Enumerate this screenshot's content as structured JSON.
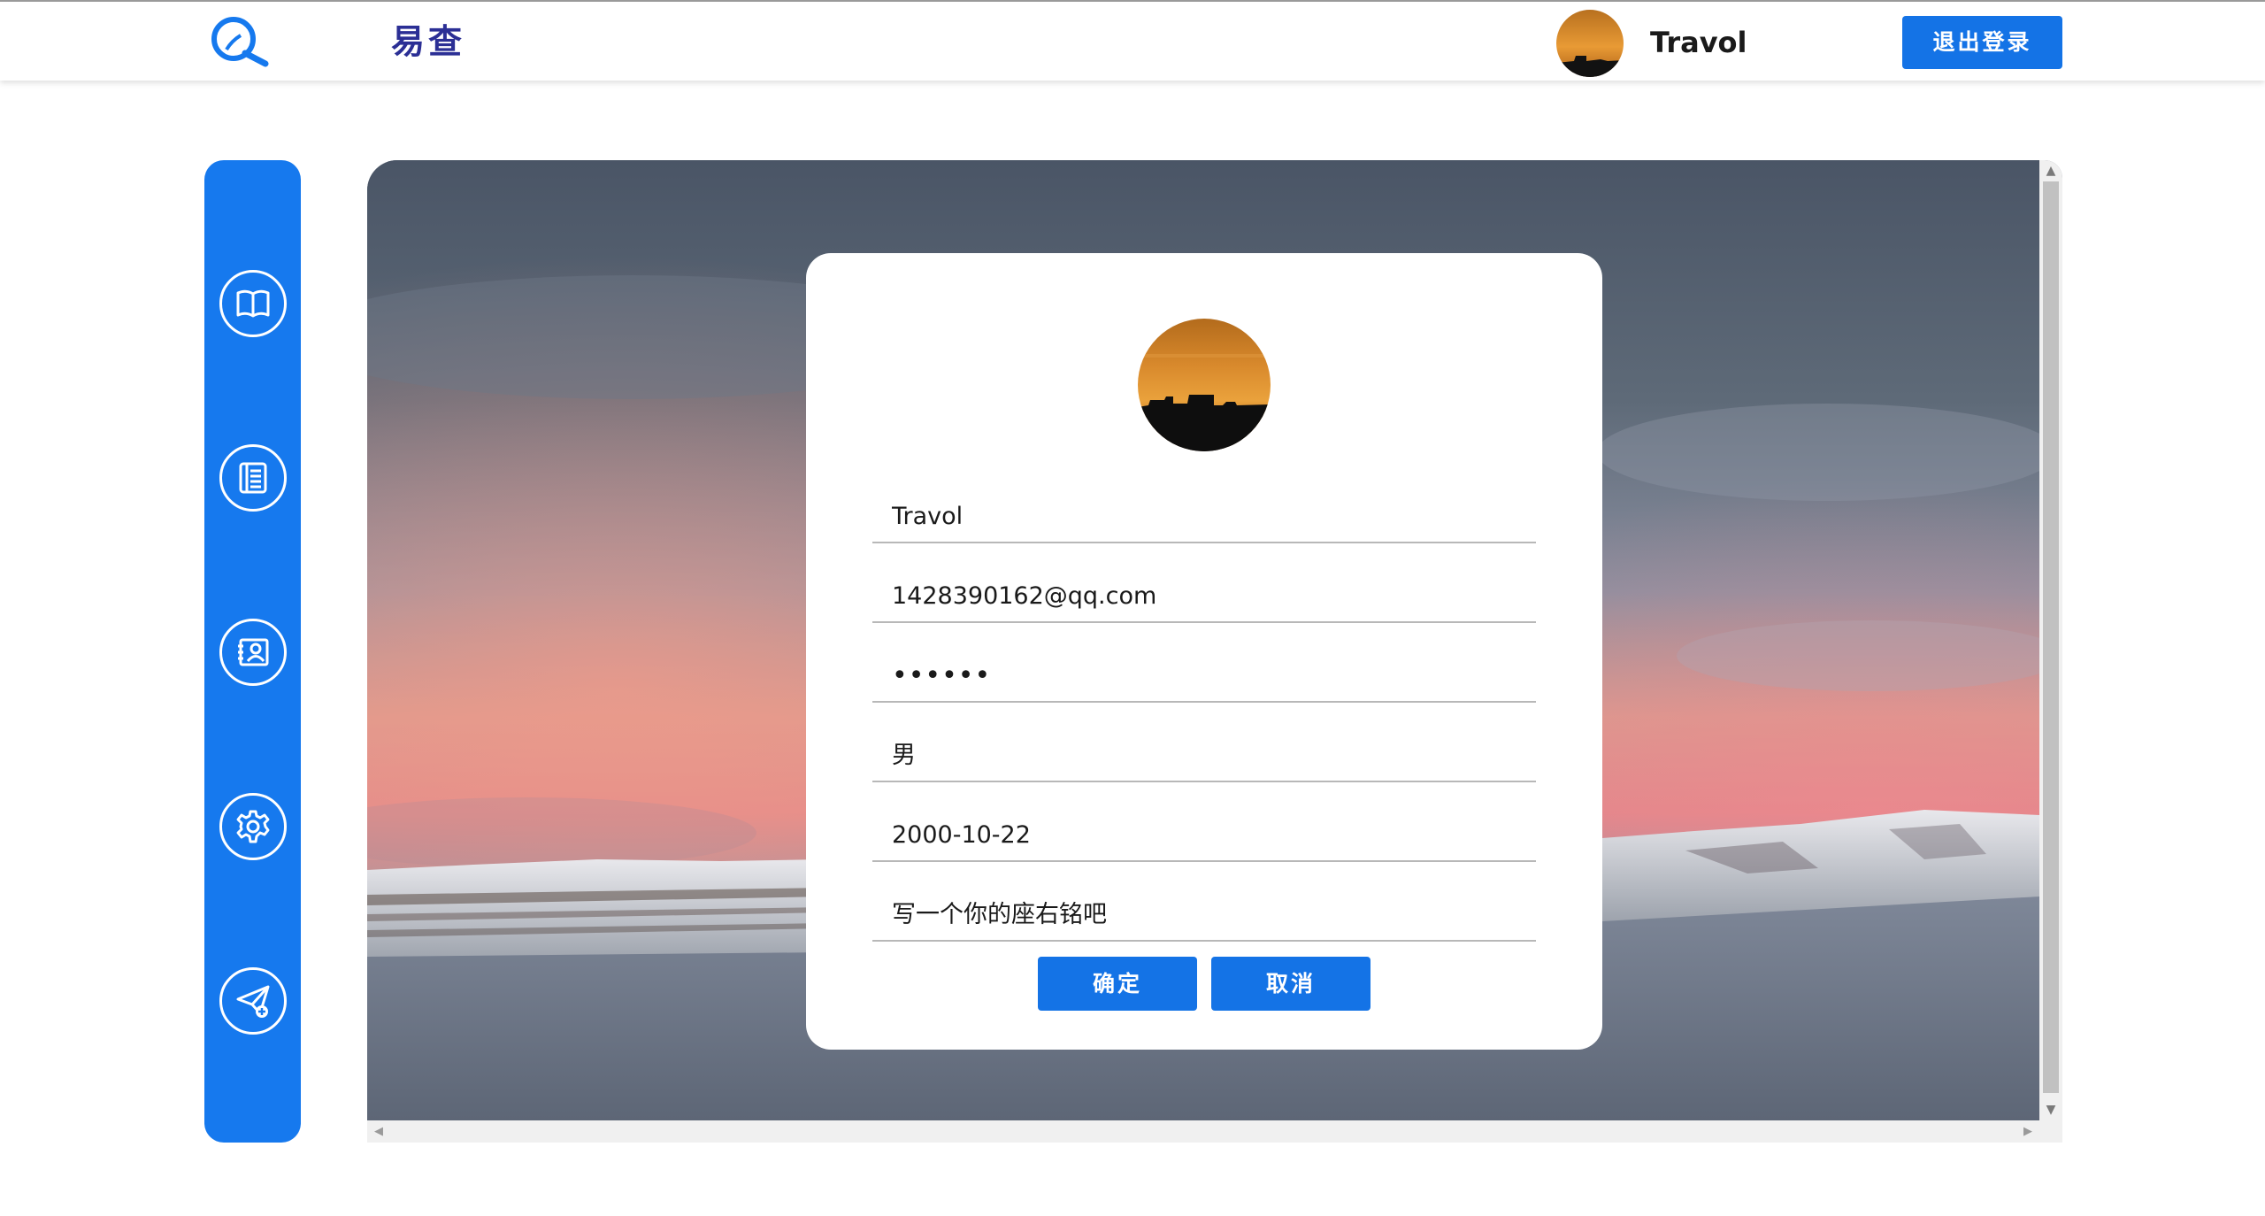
{
  "header": {
    "app_title": "易查",
    "username": "Travol",
    "logout_label": "退出登录"
  },
  "sidebar": {
    "items": [
      {
        "name": "book-icon"
      },
      {
        "name": "list-icon"
      },
      {
        "name": "contact-card-icon"
      },
      {
        "name": "gear-icon"
      },
      {
        "name": "send-plane-icon"
      }
    ]
  },
  "profile": {
    "username": "Travol",
    "email": "1428390162@qq.com",
    "password": "••••••",
    "gender": "男",
    "birthday": "2000-10-22",
    "motto_placeholder": "写一个你的座右铭吧",
    "confirm_label": "确定",
    "cancel_label": "取消"
  },
  "colors": {
    "accent": "#1473e6",
    "sidebar": "#1679ee",
    "title": "#2b2f95"
  }
}
